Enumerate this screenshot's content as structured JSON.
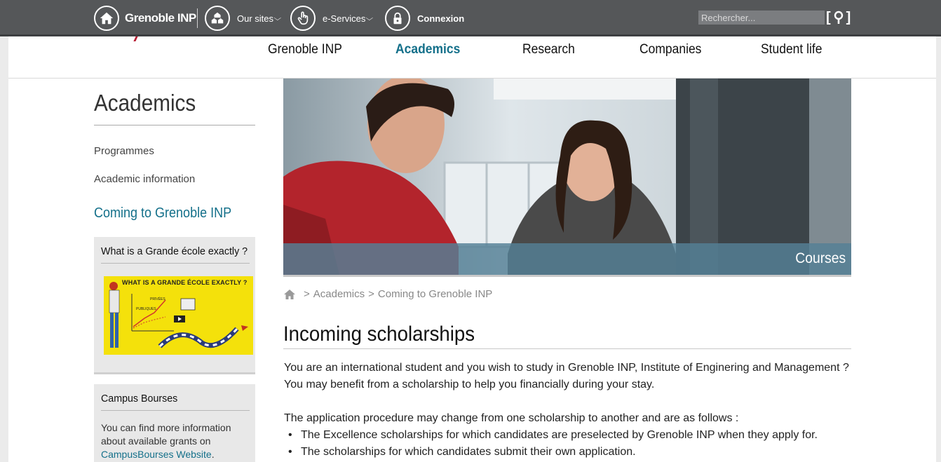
{
  "topbar": {
    "brand": "Grenoble INP",
    "our_sites": "Our sites",
    "e_services": "e-Services",
    "connexion": "Connexion",
    "search_placeholder": "Rechercher...",
    "search_bracket_left": "[",
    "search_bracket_right": "]"
  },
  "nav": {
    "items": [
      {
        "label": "Grenoble INP",
        "active": false
      },
      {
        "label": "Academics",
        "active": true
      },
      {
        "label": "Research",
        "active": false
      },
      {
        "label": "Companies",
        "active": false
      },
      {
        "label": "Student life",
        "active": false
      }
    ]
  },
  "sidebar": {
    "title": "Academics",
    "links": [
      "Programmes",
      "Academic information"
    ],
    "current": "Coming to Grenoble INP",
    "box1": {
      "title": "What is a Grande école exactly ?",
      "thumbnail_text": "WHAT IS A GRANDE ÉCOLE EXACTLY ?",
      "thumbnail_small1": "PRIVÉES",
      "thumbnail_small2": "PUBLIQUES"
    },
    "box2": {
      "title": "Campus Bourses",
      "text": "You can find more information about available grants on ",
      "link": "CampusBourses Website",
      "after_link": "."
    }
  },
  "hero": {
    "caption": "Courses"
  },
  "breadcrumb": {
    "sep": ">",
    "items": [
      "Academics",
      "Coming to Grenoble INP"
    ]
  },
  "content": {
    "heading": "Incoming scholarships",
    "p1_line1": "You are an international student and you wish to study in Grenoble INP, Institute of Enginering and Management ?",
    "p1_line2": "You may benefit from a scholarship to help you financially during your stay.",
    "p2": "The application procedure may change from one scholarship to another and are as follows :",
    "bullets": [
      "The Excellence scholarships for which candidates are preselected by Grenoble INP when they apply for.",
      "The scholarships for which candidates submit their own application."
    ]
  },
  "colors": {
    "topbar": "#555759",
    "accent": "#14708a",
    "caption_band": "#548096",
    "brand_red": "#b71e34"
  }
}
